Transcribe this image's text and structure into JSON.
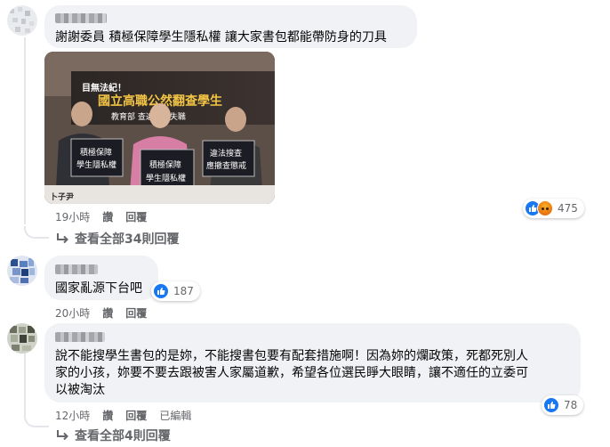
{
  "comments": [
    {
      "text": "謝謝委員 積極保障學生隱私權 讓大家書包都能帶防身的刀具",
      "time": "19小時",
      "reply_label": "讚",
      "reply2_label": "回覆",
      "reaction_count": "475",
      "reactions": [
        "like-icon",
        "angry-icon"
      ],
      "photo": {
        "banner_line1": "目無法紀！",
        "banner_line2": "國立高職公然翻查學生",
        "banner_line3": "教育部 查違法及失職",
        "sign_left": [
          "積極保障",
          "學生隱私權"
        ],
        "sign_center": [
          "積極保障",
          "學生隱私權"
        ],
        "sign_right": [
          "違法搜查",
          "應撤查懲戒"
        ],
        "bottom_tag": "卜子尹"
      },
      "view_replies": "查看全部34則回覆"
    },
    {
      "text": "國家亂源下台吧",
      "time": "20小時",
      "reply_label": "讚",
      "reply2_label": "回覆",
      "reaction_count": "187"
    },
    {
      "text_lines": [
        "說不能搜學生書包的是妳，不能搜書包要有配套措施啊！因為妳的爛政策，死都死別人",
        "家的小孩，妳要不要去跟被害人家屬道歉，希望各位選民睜大眼睛，讓不適任的立委可",
        "以被淘汰"
      ],
      "time": "12小時",
      "reply_label": "讚",
      "reply2_label": "回覆",
      "edited_label": "已編輯",
      "reaction_count": "78",
      "view_replies": "查看全部4則回覆"
    }
  ],
  "colors": {
    "bubble": "#f0f2f5",
    "meta": "#65676b",
    "like": "#1877f2"
  }
}
